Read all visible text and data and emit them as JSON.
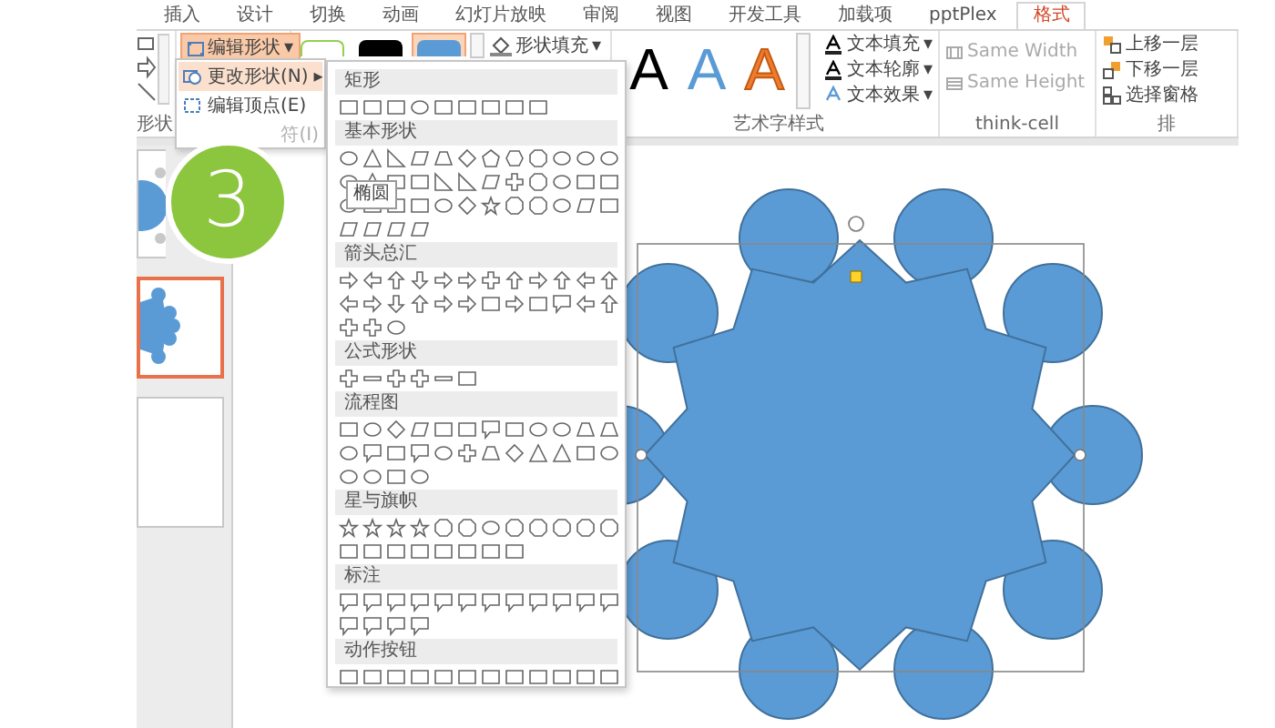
{
  "tabs": [
    {
      "label": "插入",
      "selected": false
    },
    {
      "label": "设计",
      "selected": false
    },
    {
      "label": "切换",
      "selected": false
    },
    {
      "label": "动画",
      "selected": false
    },
    {
      "label": "幻灯片放映",
      "selected": false
    },
    {
      "label": "审阅",
      "selected": false
    },
    {
      "label": "视图",
      "selected": false
    },
    {
      "label": "开发工具",
      "selected": false
    },
    {
      "label": "加载项",
      "selected": false
    },
    {
      "label": "pptPlex",
      "selected": false
    },
    {
      "label": "格式",
      "selected": true
    }
  ],
  "ribbon": {
    "insert_shapes": {
      "label": "形状"
    },
    "edit_shape": {
      "label": "编辑形状",
      "caret": "▾",
      "active": true
    },
    "shape_styles": [
      {
        "color": "#ffffff",
        "selected": false
      },
      {
        "color": "#000000",
        "selected": false
      },
      {
        "color": "#5b9bd5",
        "selected": true
      }
    ],
    "shape_fill": {
      "label": "形状填充",
      "caret": "▾"
    },
    "wordart": {
      "label": "艺术字样式",
      "styles": [
        {
          "letter": "A",
          "kind": "solid",
          "color": "#000000"
        },
        {
          "letter": "A",
          "kind": "solid",
          "color": "#5b9bd5"
        },
        {
          "letter": "A",
          "kind": "outline",
          "color": "#ed7d31"
        }
      ],
      "commands": [
        {
          "label": "文本填充",
          "caret": "▾"
        },
        {
          "label": "文本轮廓",
          "caret": "▾"
        },
        {
          "label": "文本效果",
          "caret": "▾"
        }
      ]
    },
    "think_cell": {
      "label": "think-cell",
      "buttons": [
        {
          "label": "Same Width",
          "disabled": true
        },
        {
          "label": "Same Height",
          "disabled": true
        }
      ]
    },
    "arrange": {
      "label": "排",
      "buttons": [
        "上移一层",
        "下移一层",
        "选择窗格"
      ]
    }
  },
  "menu": {
    "items": [
      {
        "label": "更改形状(N)",
        "selected": true,
        "disabled": false,
        "arrow": "▸"
      },
      {
        "label": "编辑顶点(E)",
        "selected": false,
        "disabled": false
      },
      {
        "label": "符(I)",
        "selected": false,
        "disabled": true
      }
    ]
  },
  "shape_gallery": {
    "sections": [
      {
        "title": "矩形"
      },
      {
        "title": "基本形状"
      },
      {
        "title": "箭头总汇"
      },
      {
        "title": "公式形状"
      },
      {
        "title": "流程图"
      },
      {
        "title": "星与旗帜"
      },
      {
        "title": "标注"
      },
      {
        "title": "动作按钮"
      }
    ]
  },
  "tooltip": "椭圆",
  "step_badge": "3",
  "slides": [
    {
      "selected": false
    },
    {
      "selected": true
    },
    {
      "selected": false
    }
  ]
}
